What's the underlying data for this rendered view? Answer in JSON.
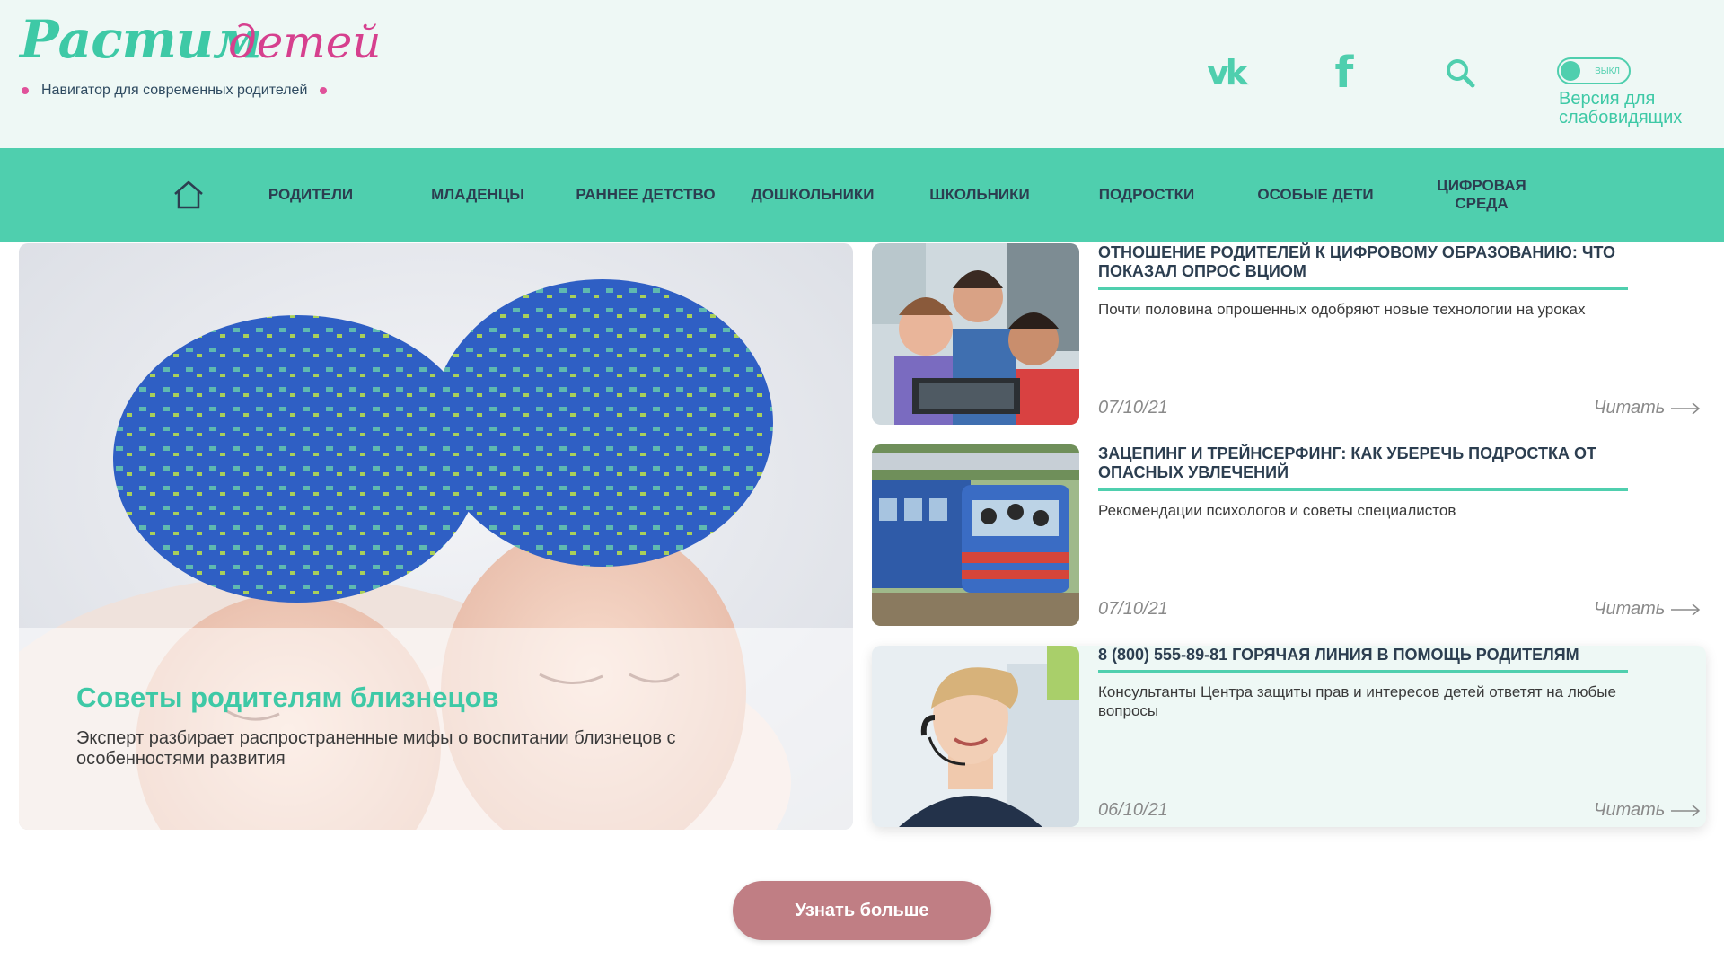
{
  "header": {
    "logo_word1": "Растим",
    "logo_word2": "детей",
    "tagline": "Навигатор для современных родителей",
    "toggle_label": "ВЫКЛ",
    "vision_label": "Версия для слабовидящих",
    "icons": [
      "vk-icon",
      "facebook-icon",
      "search-icon"
    ],
    "vk_glyph": "vk",
    "fb_glyph": "f"
  },
  "nav": {
    "items": [
      "РОДИТЕЛИ",
      "МЛАДЕНЦЫ",
      "РАННЕЕ ДЕТСТВО",
      "ДОШКОЛЬНИКИ",
      "ШКОЛЬНИКИ",
      "ПОДРОСТКИ",
      "ОСОБЫЕ ДЕТИ",
      "ЦИФРОВАЯ СРЕДА"
    ]
  },
  "main_article": {
    "title": "Советы родителям близнецов",
    "description": "Эксперт разбирает распространенные мифы о воспитании близнецов с особенностями развития"
  },
  "articles": [
    {
      "title": "ОТНОШЕНИЕ РОДИТЕЛЕЙ К ЦИФРОВОМУ ОБРАЗОВАНИЮ: ЧТО ПОКАЗАЛ ОПРОС ВЦИОМ",
      "description": "Почти половина опрошенных одобряют новые технологии на уроках",
      "date": "07/10/21",
      "read": "Читать"
    },
    {
      "title": "ЗАЦЕПИНГ И ТРЕЙНСЕРФИНГ: КАК УБЕРЕЧЬ ПОДРОСТКА ОТ ОПАСНЫХ УВЛЕЧЕНИЙ",
      "description": "Рекомендации психологов и советы специалистов",
      "date": "07/10/21",
      "read": "Читать"
    },
    {
      "title": "8 (800) 555-89-81 ГОРЯЧАЯ ЛИНИЯ В ПОМОЩЬ РОДИТЕЛЯМ",
      "description": "Консультанты Центра защиты прав и интересов детей ответят на любые вопросы",
      "date": "06/10/21",
      "read": "Читать"
    }
  ],
  "more_button": "Узнать больше",
  "colors": {
    "accent": "#4fcfae",
    "brand_pink": "#d6408e",
    "button": "#c07e84",
    "header_bg": "#eef8f5"
  }
}
